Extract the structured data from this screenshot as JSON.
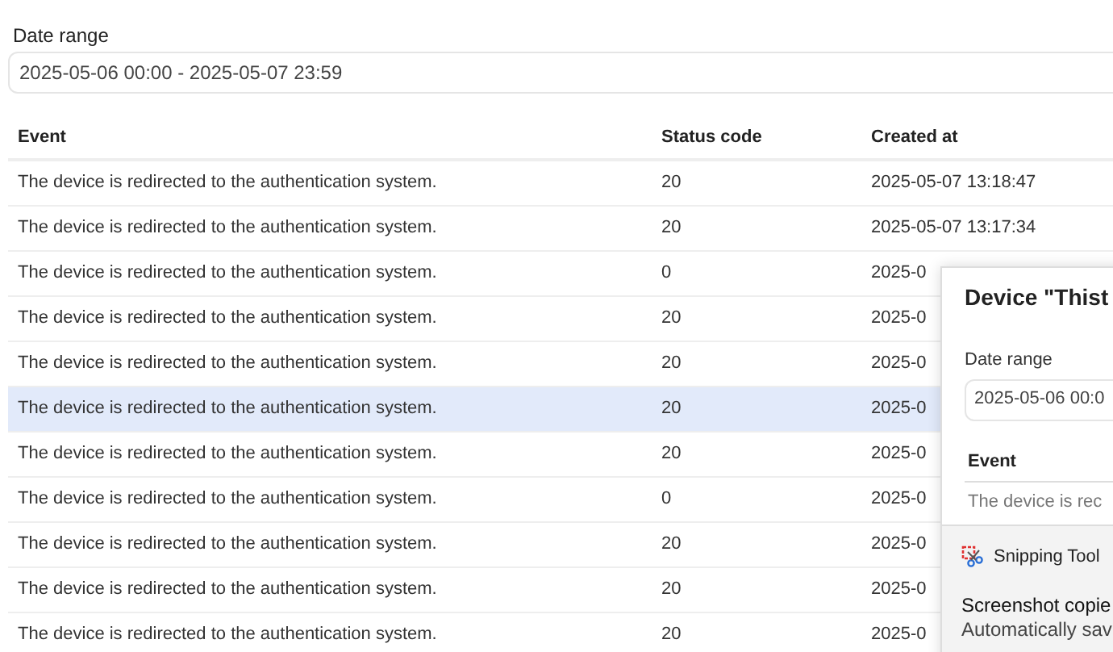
{
  "date_range": {
    "label": "Date range",
    "value": "2025-05-06 00:00 - 2025-05-07 23:59"
  },
  "table": {
    "columns": [
      "Event",
      "Status code",
      "Created at"
    ],
    "rows": [
      {
        "event": "The device is redirected to the authentication system.",
        "status_code": "20",
        "created_at": "2025-05-07 13:18:47",
        "highlighted": false
      },
      {
        "event": "The device is redirected to the authentication system.",
        "status_code": "20",
        "created_at": "2025-05-07 13:17:34",
        "highlighted": false
      },
      {
        "event": "The device is redirected to the authentication system.",
        "status_code": "0",
        "created_at": "2025-0",
        "highlighted": false
      },
      {
        "event": "The device is redirected to the authentication system.",
        "status_code": "20",
        "created_at": "2025-0",
        "highlighted": false
      },
      {
        "event": "The device is redirected to the authentication system.",
        "status_code": "20",
        "created_at": "2025-0",
        "highlighted": false
      },
      {
        "event": "The device is redirected to the authentication system.",
        "status_code": "20",
        "created_at": "2025-0",
        "highlighted": true
      },
      {
        "event": "The device is redirected to the authentication system.",
        "status_code": "20",
        "created_at": "2025-0",
        "highlighted": false
      },
      {
        "event": "The device is redirected to the authentication system.",
        "status_code": "0",
        "created_at": "2025-0",
        "highlighted": false
      },
      {
        "event": "The device is redirected to the authentication system.",
        "status_code": "20",
        "created_at": "2025-0",
        "highlighted": false
      },
      {
        "event": "The device is redirected to the authentication system.",
        "status_code": "20",
        "created_at": "2025-0",
        "highlighted": false
      },
      {
        "event": "The device is redirected to the authentication system.",
        "status_code": "20",
        "created_at": "2025-0",
        "highlighted": false
      }
    ]
  },
  "dialog": {
    "title": "Device \"Thist",
    "date_label": "Date range",
    "date_value": "2025-05-06 00:0",
    "column": "Event",
    "row": "The device is rec"
  },
  "notification": {
    "app": "Snipping Tool",
    "title": "Screenshot copie",
    "body": "Automatically sav"
  }
}
